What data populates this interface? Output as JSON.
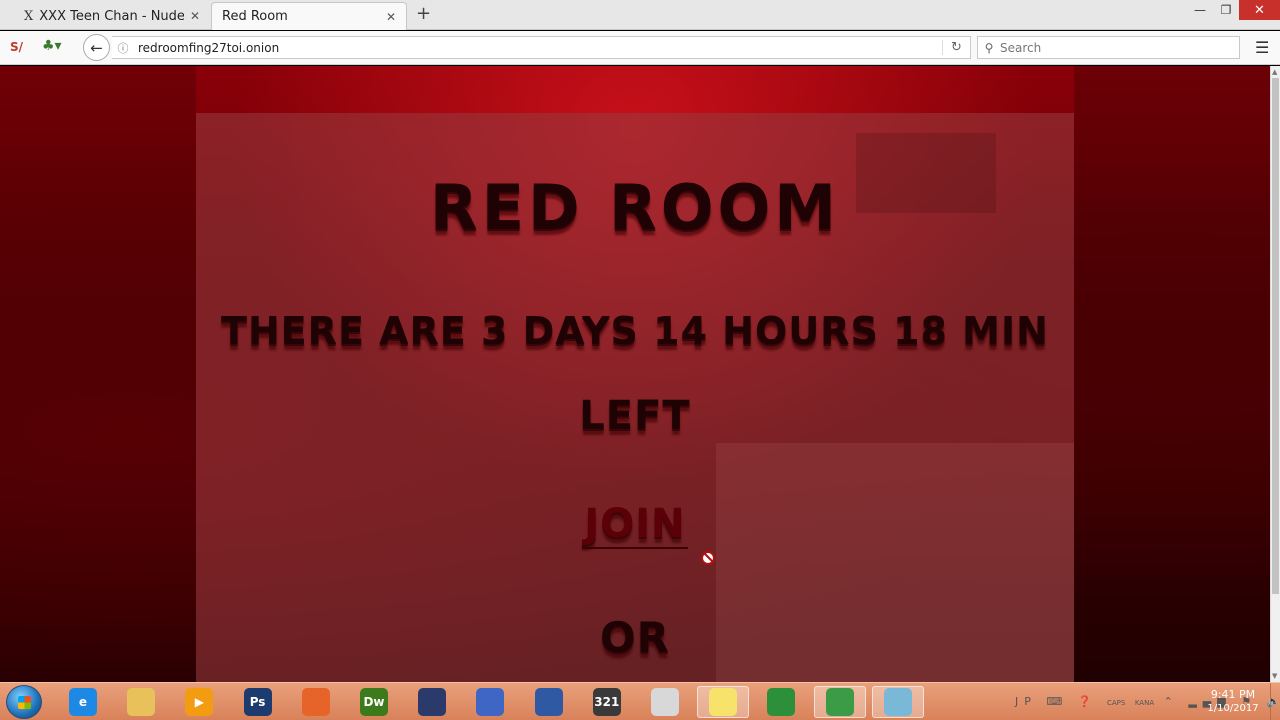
{
  "browser": {
    "tabs": [
      {
        "title": "XXX Teen Chan - Nude ...",
        "favicon": "X",
        "active": false
      },
      {
        "title": "Red Room",
        "favicon": "",
        "active": true
      }
    ],
    "new_tab_label": "+",
    "window_controls": {
      "minimize": "—",
      "maximize": "❐",
      "close": "✕"
    },
    "url": "redroomfing27toi.onion",
    "search_placeholder": "Search"
  },
  "page": {
    "title": "RED ROOM",
    "countdown_line1": "THERE ARE 3 DAYS 14 HOURS 18 MIN",
    "countdown_line2": "LEFT",
    "join_label": "JOIN",
    "or_label": "OR",
    "colors": {
      "text": "#1e0204",
      "join": "#5a0006",
      "panel": "#963c41"
    }
  },
  "taskbar": {
    "items": [
      {
        "name": "internet-explorer",
        "label": "e",
        "color": "#1e88e5",
        "active": false
      },
      {
        "name": "file-explorer",
        "label": "",
        "color": "#e8c15a",
        "active": false
      },
      {
        "name": "media-player",
        "label": "▶",
        "color": "#f39c12",
        "active": false
      },
      {
        "name": "photoshop",
        "label": "Ps",
        "color": "#1c3b6e",
        "active": false
      },
      {
        "name": "firefox",
        "label": "",
        "color": "#e6632a",
        "active": false
      },
      {
        "name": "dreamweaver",
        "label": "Dw",
        "color": "#3d7a1c",
        "active": false
      },
      {
        "name": "app-program",
        "label": "",
        "color": "#2b3a6a",
        "active": false
      },
      {
        "name": "security-shield",
        "label": "",
        "color": "#3f66c4",
        "active": false
      },
      {
        "name": "webcam-app",
        "label": "",
        "color": "#2f5aa3",
        "active": false
      },
      {
        "name": "media-player-321",
        "label": "321",
        "color": "#3a3a3a",
        "active": false
      },
      {
        "name": "text-tool",
        "label": "",
        "color": "#d8d8d8",
        "active": false
      },
      {
        "name": "sticky-notes",
        "label": "",
        "color": "#f7e26b",
        "active": true
      },
      {
        "name": "globe-browser",
        "label": "",
        "color": "#2c8f3a",
        "active": false
      },
      {
        "name": "tor-browser",
        "label": "",
        "color": "#3c9b46",
        "active": true
      },
      {
        "name": "notepad-app",
        "label": "",
        "color": "#7ab8d8",
        "active": true
      }
    ],
    "tray": {
      "lang": "JP",
      "caps": "CAPS",
      "kana": "KANA"
    },
    "clock": {
      "time": "9:41 PM",
      "date": "1/10/2017"
    }
  }
}
